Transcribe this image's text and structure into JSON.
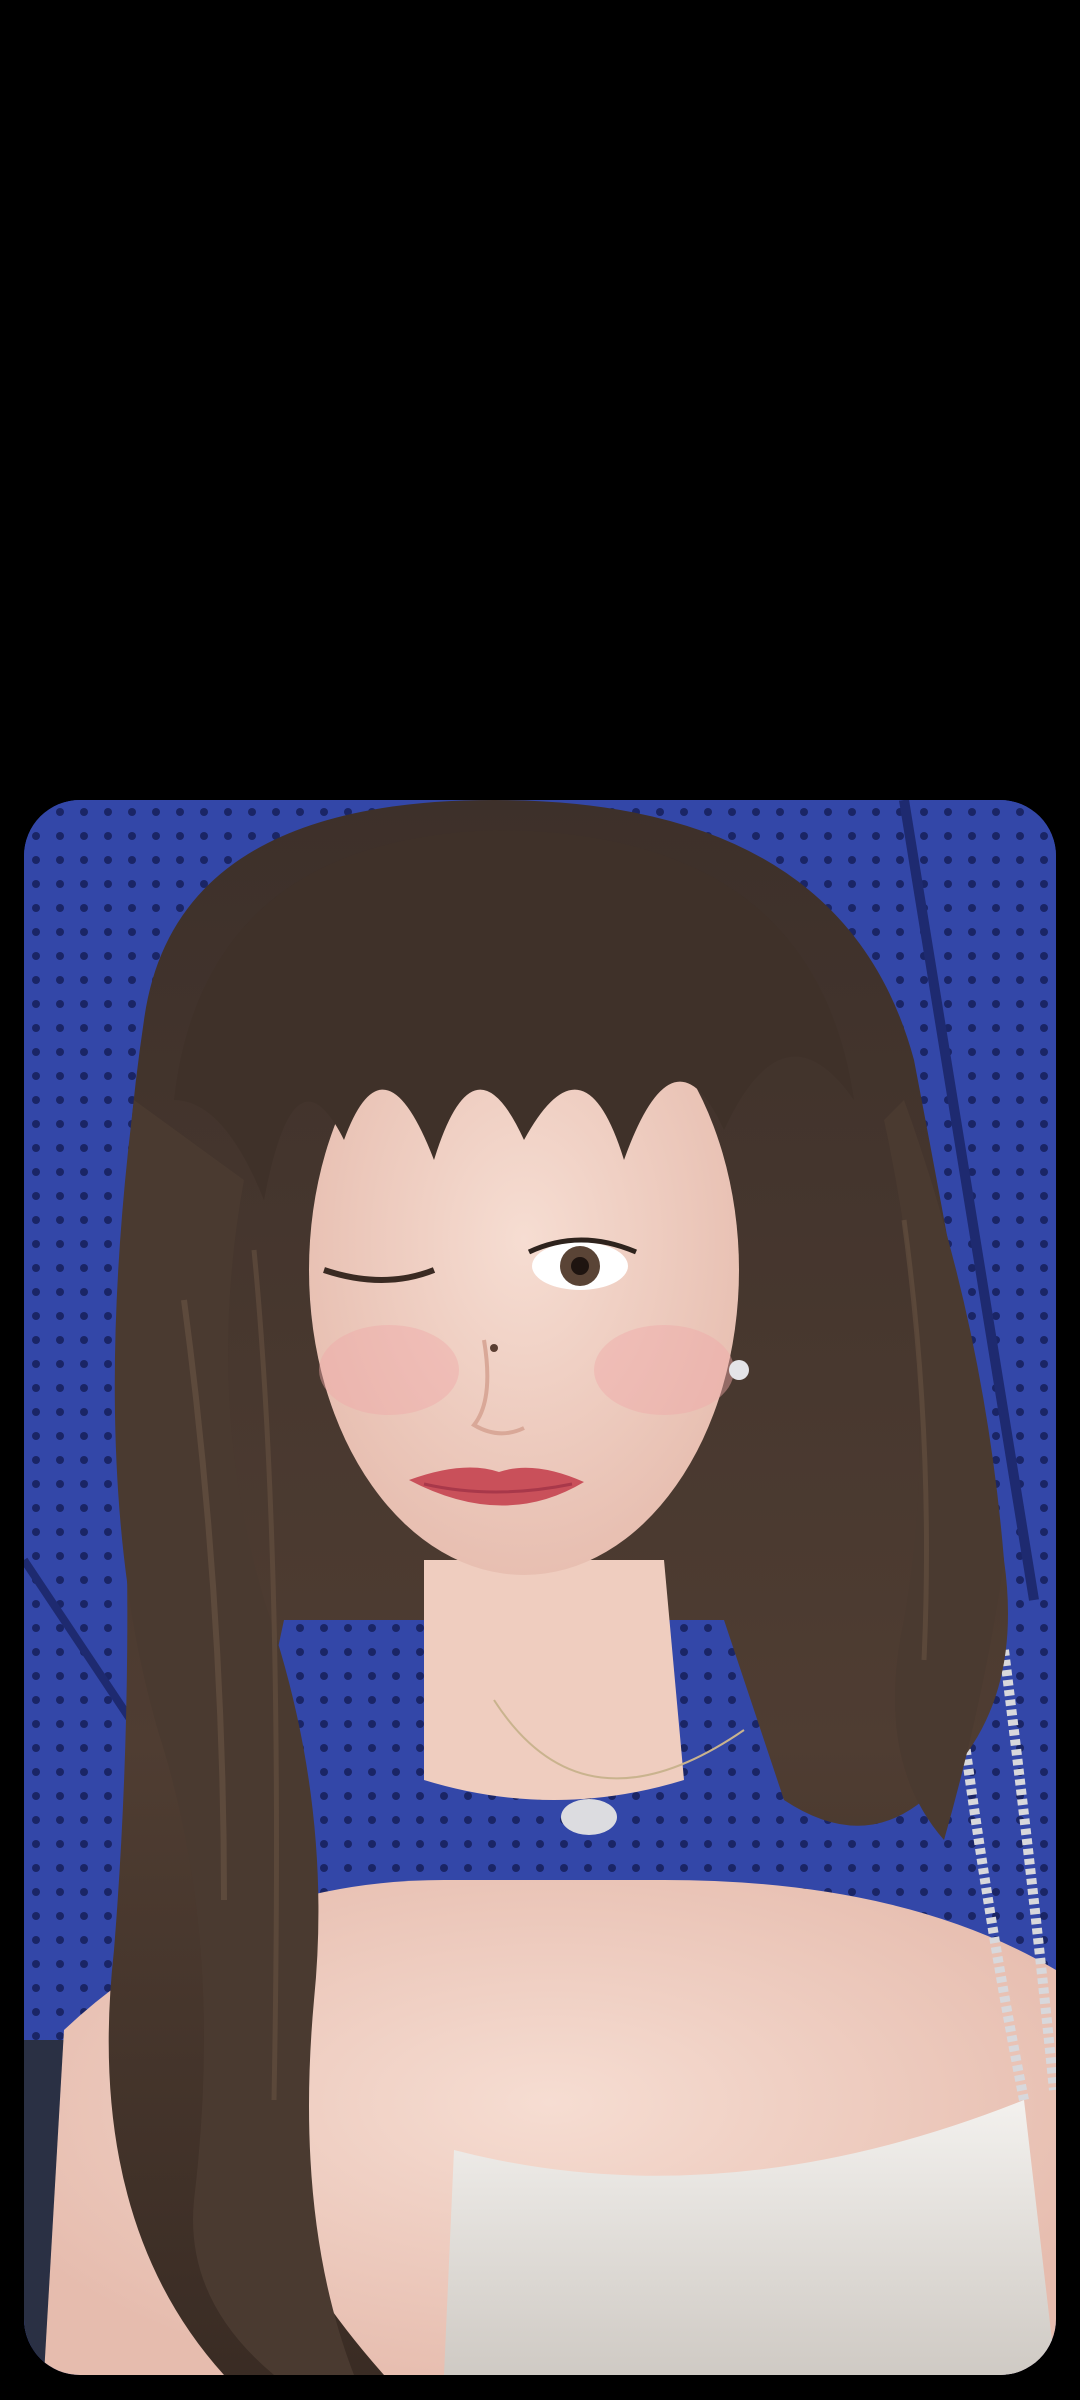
{
  "viewer": {
    "background_color": "#000000",
    "image_kind": "portrait-photo",
    "photo_palette": {
      "backdrop_blue": "#3347a8",
      "backdrop_blue_dark": "#25348a",
      "backdrop_dot": "#1a2566",
      "floor": "#2a3044",
      "hair": "#4a3a30",
      "hair_dark": "#2e231d",
      "skin": "#f2d4c8",
      "skin_shadow": "#e6bcae",
      "lips": "#c9505a",
      "dress": "#e9e6e2",
      "necklace": "#dcdce0"
    }
  }
}
